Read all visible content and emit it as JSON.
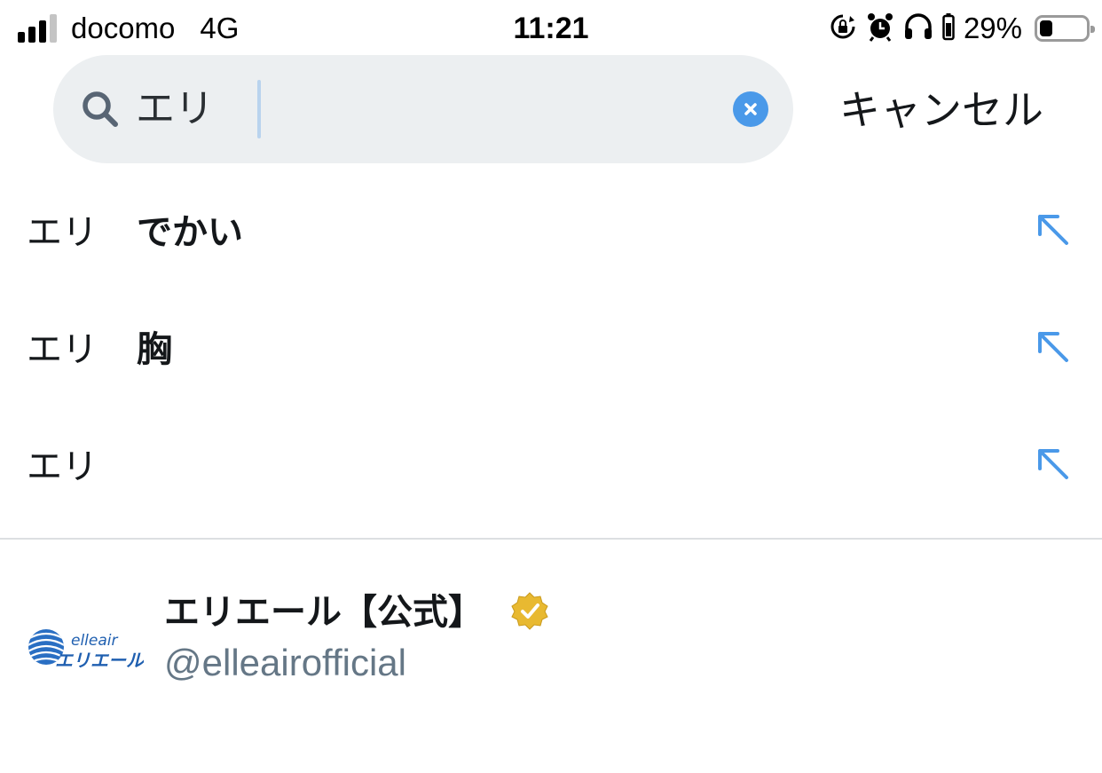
{
  "status_bar": {
    "carrier": "docomo",
    "network": "4G",
    "time": "11:21",
    "battery_percent": "29%",
    "battery_level": 0.29,
    "icons": [
      "orientation-lock-icon",
      "alarm-icon",
      "headphones-icon"
    ]
  },
  "search": {
    "query": "エリ",
    "cancel_label": "キャンセル",
    "accent_color": "#4a99e9"
  },
  "suggestions": [
    {
      "prefix": "エリ",
      "suffix": "でかい"
    },
    {
      "prefix": "エリ",
      "suffix": "胸"
    },
    {
      "prefix": "エリ",
      "suffix": ""
    }
  ],
  "user_result": {
    "name": "エリエール【公式】",
    "handle": "@elleairofficial",
    "verified": true,
    "verified_color": "#e8b931",
    "avatar_logo_text": "elleair",
    "avatar_logo_subtext": "エリエール"
  }
}
